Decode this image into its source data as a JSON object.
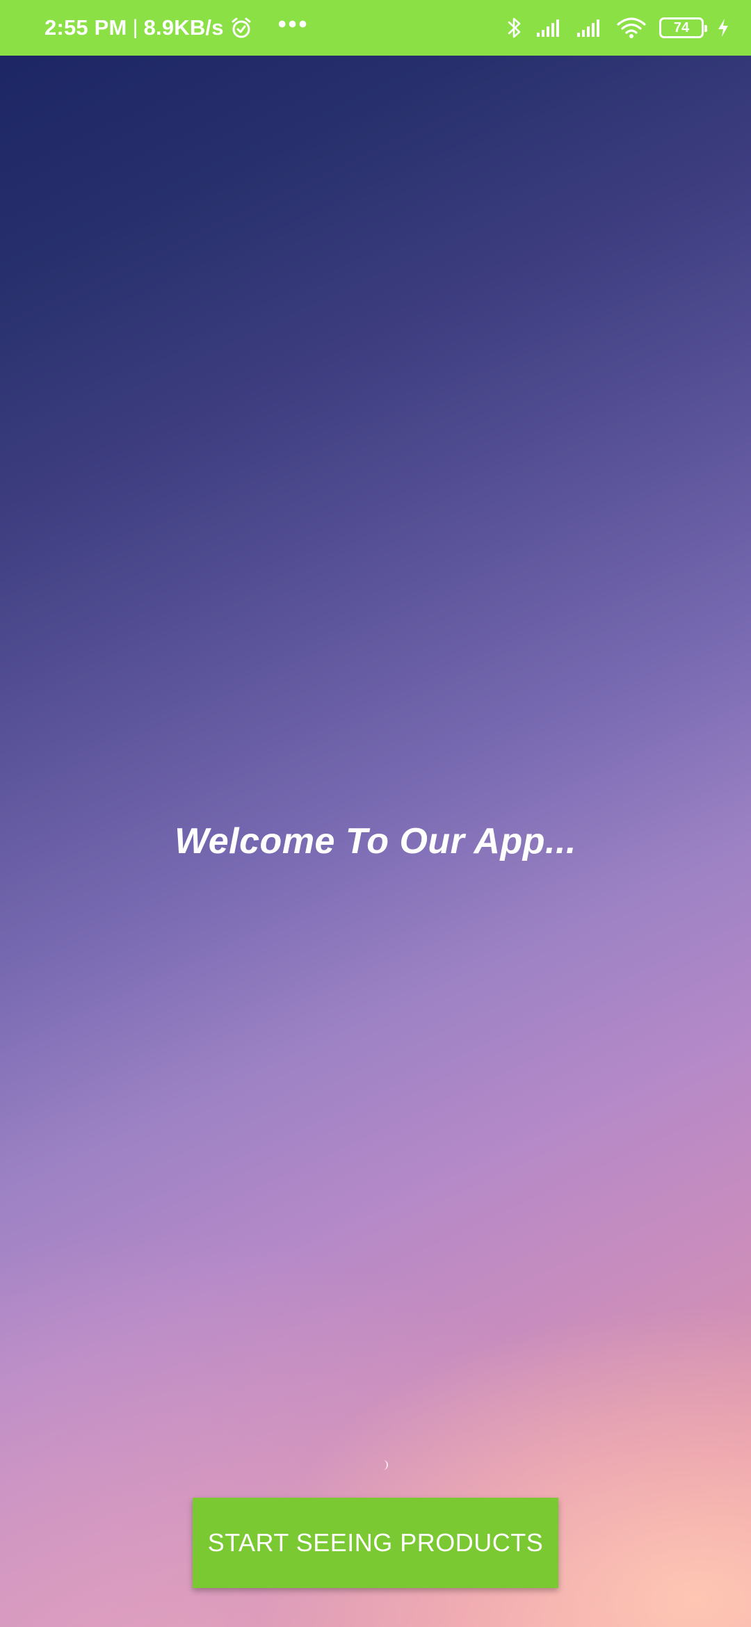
{
  "status_bar": {
    "time": "2:55 PM",
    "separator": "|",
    "network_speed": "8.9KB/s",
    "more_glyph": "•••",
    "battery_level": "74",
    "icons": [
      "alarm-icon",
      "more-icon",
      "bluetooth-icon",
      "signal-icon",
      "signal-icon",
      "wifi-icon",
      "battery-icon",
      "charging-icon"
    ],
    "background_color": "#8ae045"
  },
  "main": {
    "welcome_text": "Welcome To Our App...",
    "start_button_label": "START SEEING PRODUCTS",
    "button_color": "#7ac832"
  }
}
